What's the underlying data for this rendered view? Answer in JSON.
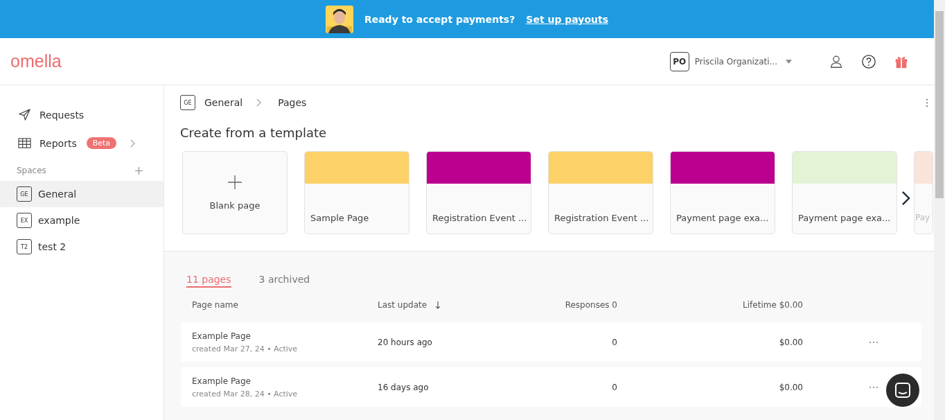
{
  "banner": {
    "message": "Ready to accept payments?",
    "link": "Set up payouts"
  },
  "header": {
    "logo": "omella",
    "org_initials": "PO",
    "org_name": "Priscila Organizati..."
  },
  "sidebar": {
    "items": [
      {
        "kind": "send",
        "label": "Requests"
      },
      {
        "kind": "table",
        "label": "Reports",
        "badge": "Beta"
      }
    ],
    "spaces_title": "Spaces",
    "spaces": [
      {
        "initials": "GE",
        "label": "General",
        "selected": true
      },
      {
        "initials": "EX",
        "label": "example",
        "selected": false
      },
      {
        "initials": "T2",
        "label": "test 2",
        "selected": false
      }
    ]
  },
  "breadcrumb": {
    "initials": "GE",
    "space": "General",
    "page": "Pages"
  },
  "templates": {
    "title": "Create from a template",
    "cards": [
      {
        "kind": "blank",
        "label": "Blank page"
      },
      {
        "kind": "template",
        "label": "Sample Page",
        "color": "#fcd168"
      },
      {
        "kind": "template",
        "label": "Registration Event ...",
        "color": "#bb008f"
      },
      {
        "kind": "template",
        "label": "Registration Event ...",
        "color": "#fcd168"
      },
      {
        "kind": "template",
        "label": "Payment page exa...",
        "color": "#bb008f"
      },
      {
        "kind": "template",
        "label": "Payment page exa...",
        "color": "#e2f3d6"
      },
      {
        "kind": "template",
        "label": "Pay",
        "color": "#fae3d8"
      }
    ]
  },
  "tabs": [
    {
      "label": "11 pages",
      "selected": true
    },
    {
      "label": "3 archived",
      "selected": false
    }
  ],
  "table": {
    "columns": [
      "Page name",
      "Last update",
      "Responses 0",
      "Lifetime $0.00"
    ],
    "rows": [
      {
        "name": "Example Page",
        "meta": "created Mar 27, 24 • Active",
        "updated": "20 hours ago",
        "responses": "0",
        "lifetime": "$0.00"
      },
      {
        "name": "Example Page",
        "meta": "created Mar 28, 24 • Active",
        "updated": "16 days ago",
        "responses": "0",
        "lifetime": "$0.00"
      }
    ]
  }
}
